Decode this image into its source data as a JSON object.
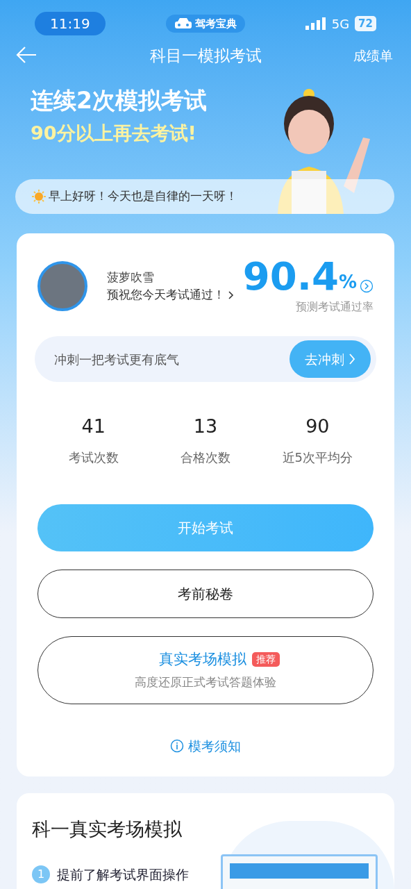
{
  "status_bar": {
    "time": "11:19",
    "app_badge": "驾考宝典",
    "network": "5G",
    "battery": "72"
  },
  "nav": {
    "title": "科目一模拟考试",
    "action": "成绩单"
  },
  "banner": {
    "line1": "连续2次模拟考试",
    "line2": "90分以上再去考试!",
    "greeting": "早上好呀！今天也是自律的一天呀！"
  },
  "profile": {
    "name": "菠萝吹雪",
    "wish": "预祝您今天考试通过！",
    "rate": "90.4",
    "rate_unit": "%",
    "rate_label": "预测考试通过率"
  },
  "sprint": {
    "text": "冲刺一把考试更有底气",
    "button": "去冲刺"
  },
  "stats": [
    {
      "value": "41",
      "label": "考试次数"
    },
    {
      "value": "13",
      "label": "合格次数"
    },
    {
      "value": "90",
      "label": "近5次平均分"
    }
  ],
  "buttons": [
    {
      "kind": "primary",
      "label": "开始考试"
    },
    {
      "kind": "outline",
      "label": "考前秘卷"
    },
    {
      "kind": "feature",
      "label": "真实考场模拟",
      "tag": "推荐",
      "subtitle": "高度还原正式考试答题体验"
    }
  ],
  "notice_link": "模考须知",
  "section": {
    "title": "科一真实考场模拟",
    "steps": [
      {
        "number": "1",
        "text": "提前了解考试界面操作"
      }
    ]
  }
}
